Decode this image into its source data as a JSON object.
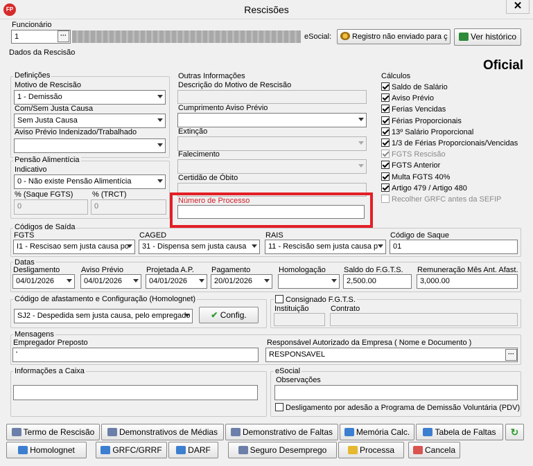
{
  "window": {
    "title": "Rescisões",
    "app_logo": "FP",
    "close": "✕"
  },
  "funcionario": {
    "label": "Funcionário",
    "value": "1",
    "esocial_label": "eSocial:",
    "registro_btn": "Registro não enviado para ç",
    "ver_historico_btn": "Ver histórico"
  },
  "dados_label": "Dados da Rescisão",
  "oficial": "Oficial",
  "definicoes": {
    "title": "Definições",
    "motivo_label": "Motivo de Rescisão",
    "motivo_value": "1 - Demissão",
    "justa_label": "Com/Sem Justa Causa",
    "justa_value": "Sem Justa Causa",
    "aviso_label": "Aviso Prévio Indenizado/Trabalhado",
    "aviso_value": ""
  },
  "pensao": {
    "title": "Pensão Alimentícia",
    "indicativo_label": "Indicativo",
    "indicativo_value": "0 - Não existe Pensão Alimentícia",
    "saque_label": "% (Saque FGTS)",
    "saque_value": "0",
    "trct_label": "% (TRCT)",
    "trct_value": "0"
  },
  "outras": {
    "title": "Outras Informações",
    "descricao_label": "Descrição do Motivo de Rescisão",
    "cumprimento_label": "Cumprimento Aviso Prévio",
    "extincao_label": "Extinção",
    "falecimento_label": "Falecimento",
    "certidao_label": "Certidão de Óbito",
    "processo_label": "Número de Processo"
  },
  "calculos": {
    "title": "Cálculos",
    "items": [
      {
        "label": "Saldo de Salário",
        "checked": true,
        "disabled": false
      },
      {
        "label": "Aviso Prévio",
        "checked": true,
        "disabled": false
      },
      {
        "label": "Ferias Vencidas",
        "checked": true,
        "disabled": false
      },
      {
        "label": "Férias Proporcionais",
        "checked": true,
        "disabled": false
      },
      {
        "label": "13º Salário Proporcional",
        "checked": true,
        "disabled": false
      },
      {
        "label": "1/3 de Férias Proporcionais/Vencidas",
        "checked": true,
        "disabled": false
      },
      {
        "label": "FGTS Rescisão",
        "checked": true,
        "disabled": true
      },
      {
        "label": "FGTS Anterior",
        "checked": true,
        "disabled": false
      },
      {
        "label": "Multa FGTS 40%",
        "checked": true,
        "disabled": false
      },
      {
        "label": "Artigo 479 / Artigo 480",
        "checked": true,
        "disabled": false
      },
      {
        "label": "Recolher GRFC antes da SEFIP",
        "checked": false,
        "disabled": true
      }
    ]
  },
  "codigos": {
    "title": "Códigos de Saída",
    "fgts_label": "FGTS",
    "fgts_value": "I1 - Rescisao sem justa causa po",
    "caged_label": "CAGED",
    "caged_value": "31  - Dispensa sem justa causa",
    "rais_label": "RAIS",
    "rais_value": "11 - Rescisão sem justa causa p",
    "saque_label": "Código de Saque",
    "saque_value": "01"
  },
  "datas": {
    "title": "Datas",
    "desligamento_label": "Desligamento",
    "desligamento_value": "04/01/2026",
    "aviso_label": "Aviso Prévio",
    "aviso_value": "04/01/2026",
    "projetada_label": "Projetada A.P.",
    "projetada_value": "04/01/2026",
    "pagamento_label": "Pagamento",
    "pagamento_value": "20/01/2026",
    "homologacao_label": "Homologação",
    "homologacao_value": "",
    "saldo_label": "Saldo do F.G.T.S.",
    "saldo_value": "2,500.00",
    "remuneracao_label": "Remuneração Mês Ant. Afast.",
    "remuneracao_value": "3,000.00"
  },
  "afastamento": {
    "title": "Código de afastamento e Configuração (Homolognet)",
    "value": "SJ2 - Despedida sem justa causa, pelo empregado",
    "config_btn": "Config."
  },
  "consignado": {
    "label": "Consignado F.G.T.S.",
    "instituicao_label": "Instituição",
    "contrato_label": "Contrato"
  },
  "mensagens": {
    "title": "Mensagens",
    "preposto_label": "Empregador Preposto",
    "preposto_value": "'",
    "responsavel_label": "Responsável Autorizado da Empresa ( Nome e Documento )",
    "responsavel_value": "RESPONSAVEL"
  },
  "caixa": {
    "title": "Informações a Caixa"
  },
  "esocial": {
    "title": "eSocial",
    "obs_label": "Observações",
    "pdv_label": "Desligamento por adesão a Programa de Demissão Voluntária (PDV)"
  },
  "buttons_row1": [
    "Termo de Rescisão",
    "Demonstrativos de Médias",
    "Demonstrativo de Faltas",
    "Memória Calc.",
    "Tabela de Faltas"
  ],
  "buttons_row2": [
    "Homolognet",
    "GRFC/GRRF",
    "DARF",
    "Seguro Desemprego",
    "Processa",
    "Cancela"
  ]
}
